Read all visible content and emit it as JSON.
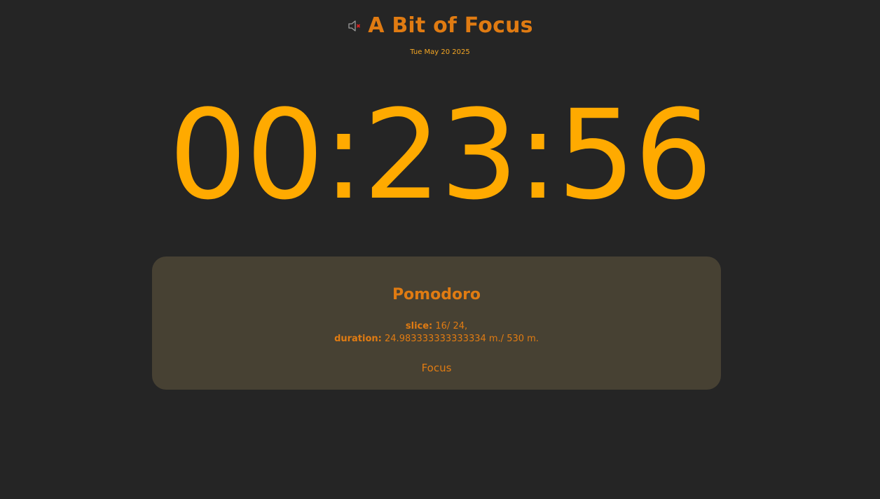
{
  "header": {
    "title": "A Bit of Focus",
    "mute_icon": "speaker-muted-icon"
  },
  "date": "Tue May 20 2025",
  "timer": {
    "display": "00:23:56"
  },
  "card": {
    "title": "Pomodoro",
    "slice_label": "slice:",
    "slice_value": "16/ 24,",
    "duration_label": "duration:",
    "duration_value": "24.983333333333334 m./ 530 m.",
    "mode": "Focus"
  },
  "colors": {
    "background": "#252525",
    "accent_orange": "#e07b12",
    "clock_amber": "#ffaa00",
    "card_background": "#474133",
    "mute_x_red": "#e02020"
  }
}
